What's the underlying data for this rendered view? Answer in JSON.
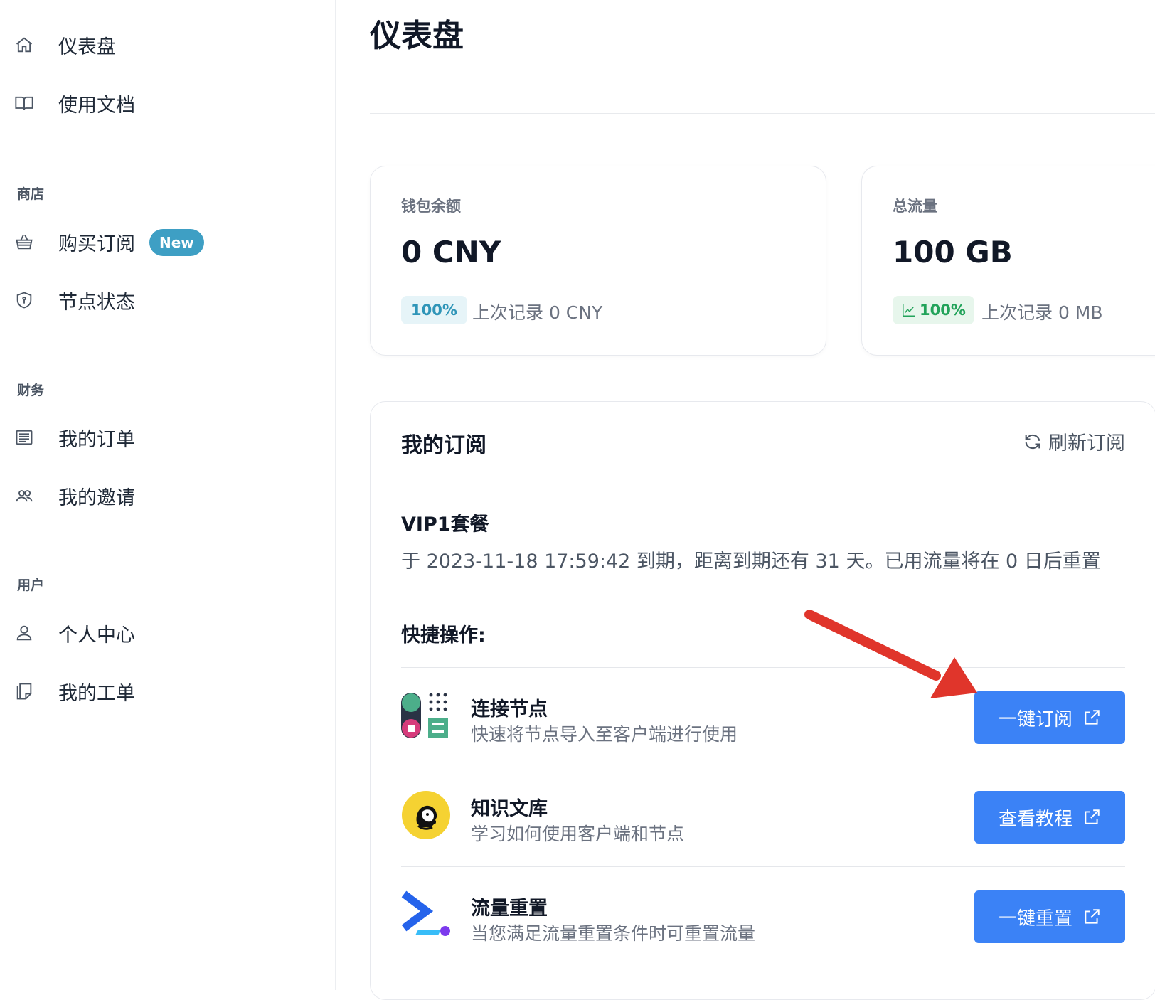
{
  "sidebar": {
    "items": [
      {
        "label": "仪表盘",
        "icon": "home-icon"
      },
      {
        "label": "使用文档",
        "icon": "book-icon"
      }
    ],
    "sections": [
      {
        "title": "商店",
        "items": [
          {
            "label": "购买订阅",
            "icon": "basket-icon",
            "badge": "New"
          },
          {
            "label": "节点状态",
            "icon": "shield-icon"
          }
        ]
      },
      {
        "title": "财务",
        "items": [
          {
            "label": "我的订单",
            "icon": "receipt-icon"
          },
          {
            "label": "我的邀请",
            "icon": "users-icon"
          }
        ]
      },
      {
        "title": "用户",
        "items": [
          {
            "label": "个人中心",
            "icon": "user-icon"
          },
          {
            "label": "我的工单",
            "icon": "ticket-icon"
          }
        ]
      }
    ]
  },
  "main": {
    "title": "仪表盘",
    "stats": [
      {
        "label": "钱包余额",
        "value": "0 CNY",
        "change": "100%",
        "last": "上次记录 0 CNY"
      },
      {
        "label": "总流量",
        "value": "100 GB",
        "change": "100%",
        "last": "上次记录 0 MB"
      }
    ],
    "subscription": {
      "title": "我的订阅",
      "refresh_label": "刷新订阅",
      "plan_name": "VIP1套餐",
      "plan_desc": "于 2023-11-18 17:59:42 到期，距离到期还有 31 天。已用流量将在 0 日后重置",
      "quick_title": "快捷操作:",
      "actions": [
        {
          "title": "连接节点",
          "subtitle": "快速将节点导入至客户端进行使用",
          "button": "一键订阅",
          "icon": "connect-nodes-icon"
        },
        {
          "title": "知识文库",
          "subtitle": "学习如何使用客户端和节点",
          "button": "查看教程",
          "icon": "knowledge-base-icon"
        },
        {
          "title": "流量重置",
          "subtitle": "当您满足流量重置条件时可重置流量",
          "button": "一键重置",
          "icon": "traffic-reset-icon"
        }
      ]
    }
  },
  "colors": {
    "primary": "#3b82f6",
    "badge": "#3e9fc4",
    "arrow": "#e0352b",
    "pill_blue_bg": "#e6f4f8",
    "pill_green_bg": "#e7f6ec"
  }
}
